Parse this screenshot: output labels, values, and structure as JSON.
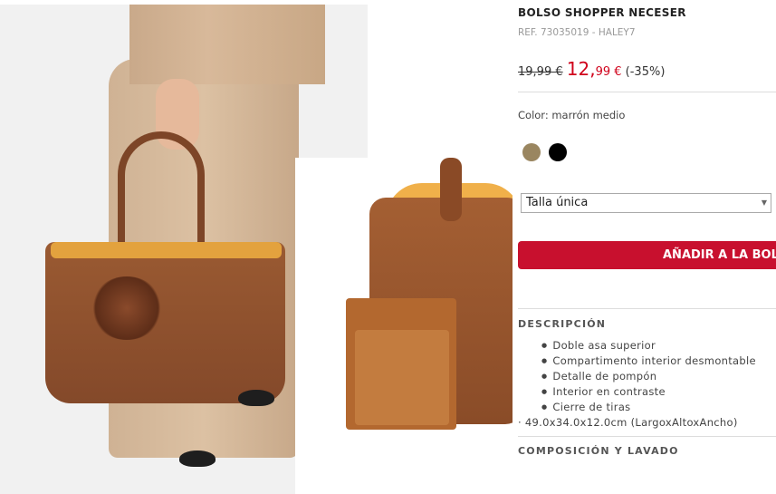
{
  "product": {
    "title": "BOLSO SHOPPER NECESER",
    "ref": "REF. 73035019 - HALEY7",
    "old_price": "19,99 €",
    "new_price_int": "12,",
    "new_price_dec": "99 €",
    "discount": "(-35%)",
    "color_label": "Color: marrón medio",
    "colors": [
      {
        "name": "marrón medio",
        "hex": "#9a8660"
      },
      {
        "name": "negro",
        "hex": "#000000"
      }
    ],
    "size_value": "Talla única",
    "add_to_bag_label": "AÑADIR A LA BOL",
    "description_heading": "DESCRIPCIÓN",
    "features": [
      "Doble asa superior",
      "Compartimento interior desmontable",
      "Detalle de pompón",
      "Interior en contraste",
      "Cierre de tiras"
    ],
    "dimensions": "· 49.0x34.0x12.0cm (LargoxAltoxAncho)",
    "composition_heading": "COMPOSICIÓN Y LAVADO"
  },
  "colors": {
    "accent_red": "#c8102e",
    "price_red": "#d0021b"
  }
}
